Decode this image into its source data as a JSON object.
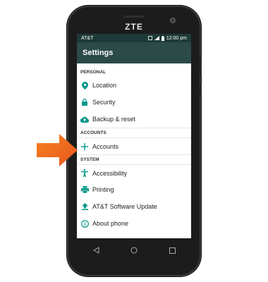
{
  "device": {
    "brand": "ZTE"
  },
  "status_bar": {
    "carrier": "AT&T",
    "time": "12:00 pm"
  },
  "app_bar": {
    "title": "Settings"
  },
  "sections": [
    {
      "header": "PERSONAL",
      "items": [
        {
          "label": "Location",
          "icon": "location-pin-icon"
        },
        {
          "label": "Security",
          "icon": "lock-icon"
        },
        {
          "label": "Backup & reset",
          "icon": "cloud-upload-icon"
        }
      ]
    },
    {
      "header": "ACCOUNTS",
      "items": [
        {
          "label": "Accounts",
          "icon": "plus-icon"
        }
      ]
    },
    {
      "header": "SYSTEM",
      "items": [
        {
          "label": "Accessibility",
          "icon": "accessibility-icon"
        },
        {
          "label": "Printing",
          "icon": "printer-icon"
        },
        {
          "label": "AT&T Software Update",
          "icon": "upload-icon"
        },
        {
          "label": "About phone",
          "icon": "info-icon"
        }
      ]
    }
  ],
  "colors": {
    "accent": "#009688",
    "app_bar": "#2b4a48",
    "status_bar": "#1e3a38",
    "pointer_arrow": "#f26522"
  },
  "navigation": [
    "back-icon",
    "home-icon",
    "recents-icon"
  ]
}
